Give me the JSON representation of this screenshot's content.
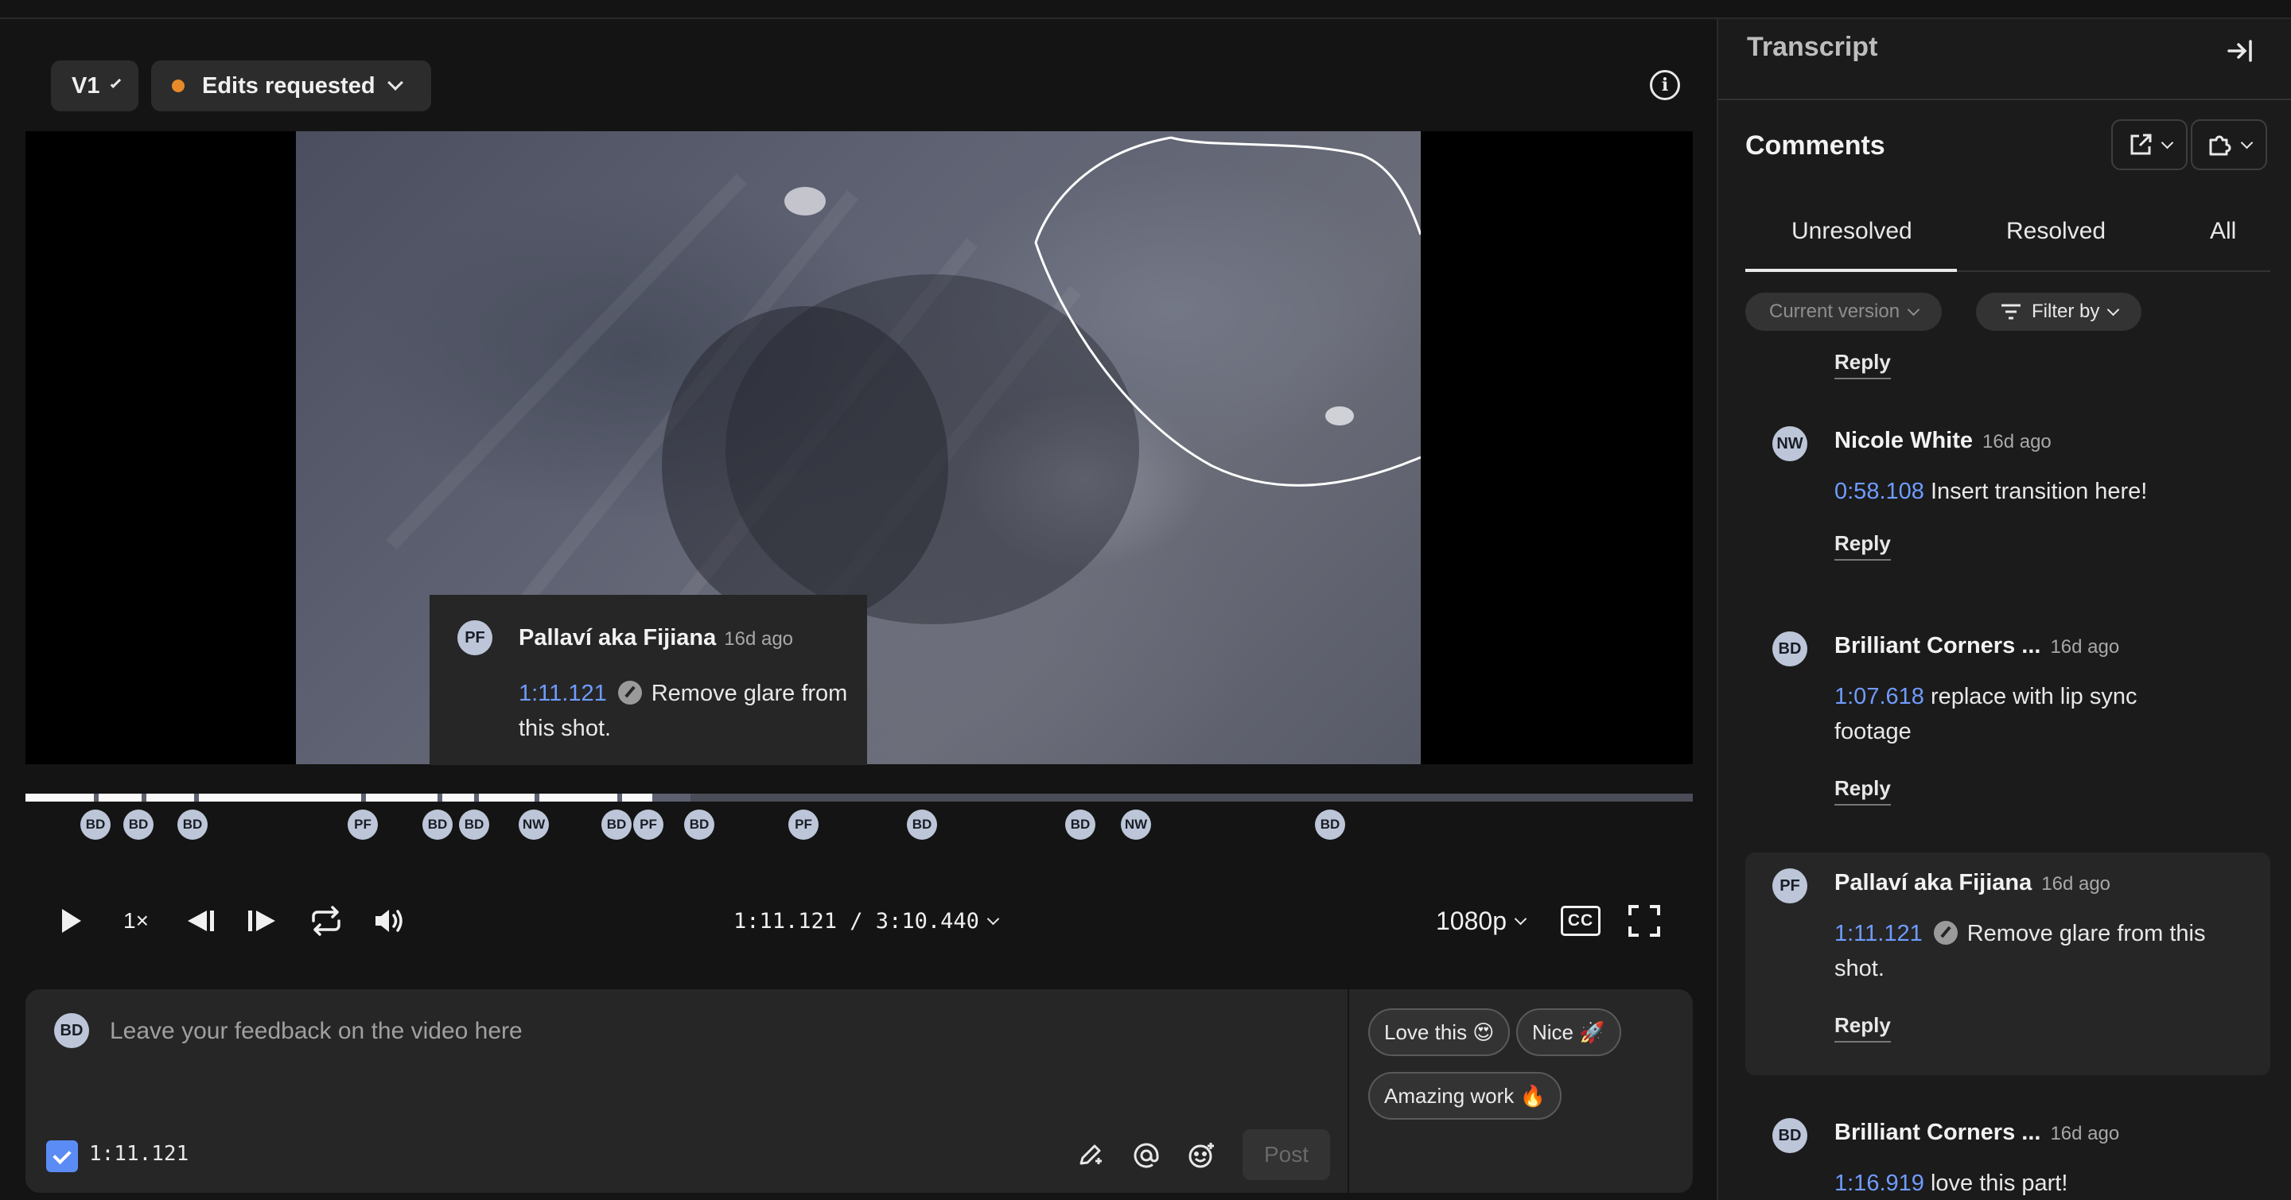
{
  "header": {
    "version_label": "V1",
    "status_label": "Edits requested",
    "status_color": "#e98a2a"
  },
  "player": {
    "tooltip": {
      "initials": "PF",
      "author": "Pallaví aka Fijiana",
      "ago": "16d ago",
      "timestamp": "1:11.121",
      "text": "Remove glare from this shot."
    },
    "markers": [
      "BD",
      "BD",
      "BD",
      "PF",
      "BD",
      "BD",
      "NW",
      "BD",
      "PF",
      "BD",
      "PF",
      "BD",
      "BD",
      "NW",
      "BD"
    ],
    "controls": {
      "speed": "1×",
      "time": "1:11.121 / 3:10.440",
      "quality": "1080p",
      "cc": "CC"
    }
  },
  "composer": {
    "initials": "BD",
    "placeholder": "Leave your feedback on the video here",
    "timestamp": "1:11.121",
    "post_label": "Post",
    "chips": [
      "Love this 😍",
      "Nice 🚀",
      "Amazing work 🔥"
    ]
  },
  "sidebar": {
    "transcript_title": "Transcript",
    "comments_title": "Comments",
    "tabs": [
      "Unresolved",
      "Resolved",
      "All"
    ],
    "filters": {
      "version": "Current version",
      "filter_by": "Filter by"
    },
    "reply_label": "Reply",
    "comments": [
      {
        "initials": "NW",
        "author": "Nicole White",
        "ago": "16d ago",
        "timestamp": "0:58.108",
        "text": "Insert transition here!"
      },
      {
        "initials": "BD",
        "author": "Brilliant Corners ...",
        "ago": "16d ago",
        "timestamp": "1:07.618",
        "text": "replace with lip sync footage"
      },
      {
        "initials": "PF",
        "author": "Pallaví aka Fijiana",
        "ago": "16d ago",
        "timestamp": "1:11.121",
        "text": "Remove glare from this shot."
      },
      {
        "initials": "BD",
        "author": "Brilliant Corners ...",
        "ago": "16d ago",
        "timestamp": "1:16.919",
        "text": "love this part!"
      }
    ]
  }
}
